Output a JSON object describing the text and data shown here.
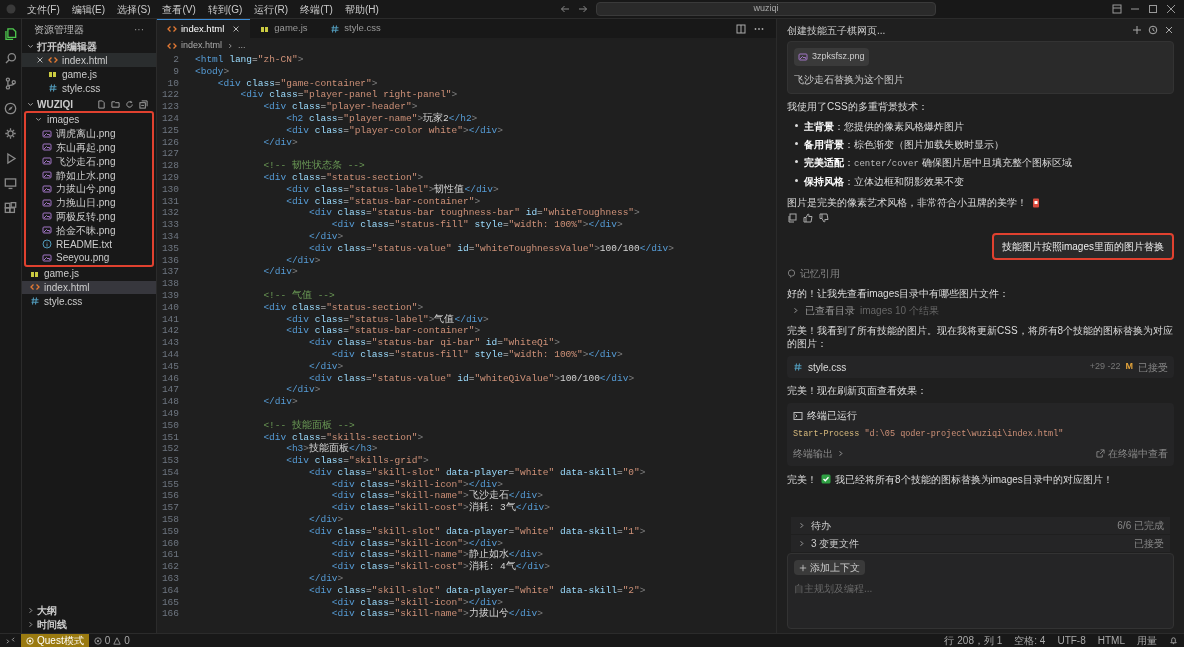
{
  "menu": [
    "文件(F)",
    "编辑(E)",
    "选择(S)",
    "查看(V)",
    "转到(G)",
    "运行(R)",
    "终端(T)",
    "帮助(H)"
  ],
  "title_search": "wuziqi",
  "activity_bar": [
    {
      "selected": true
    },
    {
      "selected": false
    },
    {
      "selected": false
    },
    {
      "selected": false
    },
    {
      "selected": false
    },
    {
      "selected": false
    },
    {
      "selected": false
    },
    {
      "selected": false
    }
  ],
  "sidebar": {
    "title": "资源管理器",
    "more": "···",
    "open_editors": {
      "label": "打开的编辑器",
      "expanded": true,
      "items": [
        {
          "name": "index.html",
          "kind": "html",
          "closable": true,
          "selected": true
        },
        {
          "name": "game.js",
          "kind": "js",
          "closable": false,
          "selected": false
        },
        {
          "name": "style.css",
          "kind": "css",
          "closable": false,
          "selected": false
        }
      ]
    },
    "project": {
      "label": "WUZIQI",
      "expanded": true,
      "tree": [
        {
          "name": "images",
          "kind": "folder",
          "expanded": true,
          "highlighted": true,
          "selected": false,
          "children": [
            {
              "name": "调虎离山.png",
              "kind": "image",
              "selected": false
            },
            {
              "name": "东山再起.png",
              "kind": "image",
              "selected": false
            },
            {
              "name": "飞沙走石.png",
              "kind": "image",
              "selected": false
            },
            {
              "name": "静如止水.png",
              "kind": "image",
              "selected": false
            },
            {
              "name": "力拔山兮.png",
              "kind": "image",
              "selected": false
            },
            {
              "name": "力挽山日.png",
              "kind": "image",
              "selected": false
            },
            {
              "name": "两极反转.png",
              "kind": "image",
              "selected": false
            },
            {
              "name": "拾金不昧.png",
              "kind": "image",
              "selected": false
            },
            {
              "name": "README.txt",
              "kind": "text",
              "selected": false
            },
            {
              "name": "Seeyou.png",
              "kind": "image",
              "selected": false
            }
          ]
        },
        {
          "name": "game.js",
          "kind": "js",
          "selected": false
        },
        {
          "name": "index.html",
          "kind": "html",
          "selected": true
        },
        {
          "name": "style.css",
          "kind": "css",
          "selected": false
        }
      ]
    },
    "bottom_sections": [
      {
        "label": "大纲",
        "expanded": false
      },
      {
        "label": "时间线",
        "expanded": false
      }
    ]
  },
  "editor": {
    "tabs": [
      {
        "label": "index.html",
        "kind": "html",
        "selected": true,
        "closable": true
      },
      {
        "label": "game.js",
        "kind": "js",
        "selected": false,
        "closable": false
      },
      {
        "label": "style.css",
        "kind": "css",
        "selected": false,
        "closable": false
      }
    ],
    "breadcrumb": [
      "index.html",
      "..."
    ],
    "lines": [
      {
        "num": "2",
        "code": "<html lang=\"zh-CN\">"
      },
      {
        "num": "9",
        "code": "<body>"
      },
      {
        "num": "10",
        "code": "    <div class=\"game-container\">"
      },
      {
        "num": "122",
        "code": "        <div class=\"player-panel right-panel\">"
      },
      {
        "num": "123",
        "code": "            <div class=\"player-header\">"
      },
      {
        "num": "124",
        "code": "                <h2 class=\"player-name\">玩家2</h2>"
      },
      {
        "num": "125",
        "code": "                <div class=\"player-color white\"></div>"
      },
      {
        "num": "126",
        "code": "            </div>"
      },
      {
        "num": "127"
      },
      {
        "num": "128",
        "code": "            <!-- 韧性状态条 -->"
      },
      {
        "num": "129",
        "code": "            <div class=\"status-section\">"
      },
      {
        "num": "130",
        "code": "                <div class=\"status-label\">韧性值</div>"
      },
      {
        "num": "131",
        "code": "                <div class=\"status-bar-container\">"
      },
      {
        "num": "132",
        "code": "                    <div class=\"status-bar toughness-bar\" id=\"whiteToughness\">"
      },
      {
        "num": "133",
        "code": "                        <div class=\"status-fill\" style=\"width: 100%\"></div>"
      },
      {
        "num": "134",
        "code": "                    </div>"
      },
      {
        "num": "135",
        "code": "                    <div class=\"status-value\" id=\"whiteToughnessValue\">100/100</div>"
      },
      {
        "num": "136",
        "code": "                </div>"
      },
      {
        "num": "137",
        "code": "            </div>"
      },
      {
        "num": "138"
      },
      {
        "num": "139",
        "code": "            <!-- 气值 -->"
      },
      {
        "num": "140",
        "code": "            <div class=\"status-section\">"
      },
      {
        "num": "141",
        "code": "                <div class=\"status-label\">气值</div>"
      },
      {
        "num": "142",
        "code": "                <div class=\"status-bar-container\">"
      },
      {
        "num": "143",
        "code": "                    <div class=\"status-bar qi-bar\" id=\"whiteQi\">"
      },
      {
        "num": "144",
        "code": "                        <div class=\"status-fill\" style=\"width: 100%\"></div>"
      },
      {
        "num": "145",
        "code": "                    </div>"
      },
      {
        "num": "146",
        "code": "                    <div class=\"status-value\" id=\"whiteQiValue\">100/100</div>"
      },
      {
        "num": "147",
        "code": "                </div>"
      },
      {
        "num": "148",
        "code": "            </div>"
      },
      {
        "num": "149"
      },
      {
        "num": "150",
        "code": "            <!-- 技能面板 -->"
      },
      {
        "num": "151",
        "code": "            <div class=\"skills-section\">"
      },
      {
        "num": "152",
        "code": "                <h3>技能面板</h3>"
      },
      {
        "num": "153",
        "code": "                <div class=\"skills-grid\">"
      },
      {
        "num": "154",
        "code": "                    <div class=\"skill-slot\" data-player=\"white\" data-skill=\"0\">"
      },
      {
        "num": "155",
        "code": "                        <div class=\"skill-icon\"></div>"
      },
      {
        "num": "156",
        "code": "                        <div class=\"skill-name\">飞沙走石</div>"
      },
      {
        "num": "157",
        "code": "                        <div class=\"skill-cost\">消耗: 3气</div>"
      },
      {
        "num": "158",
        "code": "                    </div>"
      },
      {
        "num": "159",
        "code": "                    <div class=\"skill-slot\" data-player=\"white\" data-skill=\"1\">"
      },
      {
        "num": "160",
        "code": "                        <div class=\"skill-icon\"></div>"
      },
      {
        "num": "161",
        "code": "                        <div class=\"skill-name\">静止如水</div>"
      },
      {
        "num": "162",
        "code": "                        <div class=\"skill-cost\">消耗: 4气</div>"
      },
      {
        "num": "163",
        "code": "                    </div>"
      },
      {
        "num": "164",
        "code": "                    <div class=\"skill-slot\" data-player=\"white\" data-skill=\"2\">"
      },
      {
        "num": "165",
        "code": "                        <div class=\"skill-icon\"></div>"
      },
      {
        "num": "166",
        "code": "                        <div class=\"skill-name\">力拔山兮</div>"
      }
    ]
  },
  "chat": {
    "title": "创建技能五子棋网页...",
    "messages": [
      {
        "kind": "user_card",
        "attachment": "3zpksfsz.png",
        "text": "飞沙走石替换为这个图片"
      },
      {
        "kind": "para",
        "text": "我使用了CSS的多重背景技术："
      },
      {
        "kind": "bullets",
        "items": [
          {
            "label": "主背景",
            "text": "：您提供的像素风格爆炸图片"
          },
          {
            "label": "备用背景",
            "text": "：棕色渐变（图片加载失败时显示）"
          },
          {
            "label": "完美适配",
            "text": "：",
            "code": "center/cover",
            "rest": " 确保图片居中且填充整个图标区域"
          },
          {
            "label": "保持风格",
            "text": "：立体边框和阴影效果不变"
          }
        ]
      },
      {
        "kind": "para_icon",
        "text": "图片是完美的像素艺术风格，非常符合小丑牌的美学！"
      },
      {
        "kind": "feedback"
      },
      {
        "kind": "user_bubble",
        "text": "技能图片按照images里面的图片替换",
        "highlighted": true
      },
      {
        "kind": "memory",
        "text": "记忆引用"
      },
      {
        "kind": "para",
        "text": "好的！让我先查看images目录中有哪些图片文件："
      },
      {
        "kind": "collapsed",
        "label": "已查看目录",
        "detail": "images 10 个结果"
      },
      {
        "kind": "para",
        "text": "完美！我看到了所有技能的图片。现在我将更新CSS，将所有8个技能的图标替换为对应的图片："
      },
      {
        "kind": "file",
        "name": "style.css",
        "added": "+29",
        "removed": "-22",
        "status": "M",
        "state": "已接受"
      },
      {
        "kind": "para",
        "text": "完美！现在刷新页面查看效果："
      },
      {
        "kind": "terminal",
        "title": "终端已运行",
        "command": "Start-Process",
        "arg": "\"d:\\05 qoder-project\\wuziqi\\index.html\"",
        "output": "终端输出",
        "open": "在终端中查看"
      },
      {
        "kind": "para_check",
        "prefix": "完美！",
        "text": "我已经将所有8个技能的图标替换为images目录中的对应图片！"
      }
    ],
    "summary": [
      {
        "label": "待办",
        "status": "6/6 已完成"
      },
      {
        "label": "3 变更文件",
        "status": "已接受"
      }
    ],
    "input": {
      "context_button": "添加上下文",
      "placeholder": "自主规划及编程..."
    }
  },
  "status_bar": {
    "mode": "Quest模式",
    "errors": "0",
    "warnings": "0",
    "right": [
      "行 208，列 1",
      "空格: 4",
      "UTF-8",
      "HTML",
      "用量"
    ]
  }
}
